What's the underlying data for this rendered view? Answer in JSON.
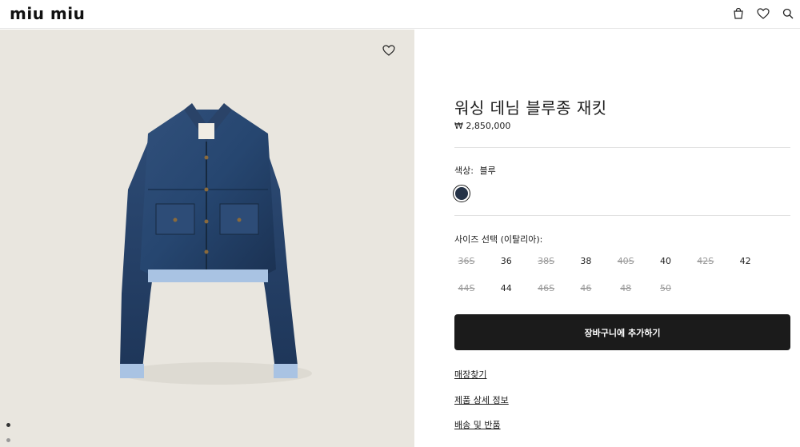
{
  "header": {
    "logo": "miu miu",
    "icons": [
      "bag-icon",
      "heart-icon",
      "search-icon"
    ]
  },
  "gallery": {
    "wishlist_icon": "heart-icon",
    "dots": 2
  },
  "product": {
    "title": "워싱 데님 블루종 재킷",
    "price": "₩ 2,850,000",
    "color_label": "색상:",
    "color_value": "블루",
    "color_swatch": "#243247",
    "size_label": "사이즈 선택 (이탈리아):",
    "sizes": [
      {
        "label": "36S",
        "available": false
      },
      {
        "label": "36",
        "available": true
      },
      {
        "label": "38S",
        "available": false
      },
      {
        "label": "38",
        "available": true
      },
      {
        "label": "40S",
        "available": false
      },
      {
        "label": "40",
        "available": true
      },
      {
        "label": "42S",
        "available": false
      },
      {
        "label": "42",
        "available": true
      },
      {
        "label": "44S",
        "available": false
      },
      {
        "label": "44",
        "available": true
      },
      {
        "label": "46S",
        "available": false
      },
      {
        "label": "46",
        "available": false
      },
      {
        "label": "48",
        "available": false
      },
      {
        "label": "50",
        "available": false
      }
    ],
    "add_to_cart": "장바구니에 추가하기",
    "links": [
      "매장찾기",
      "제품 상세 정보",
      "배송 및 반품"
    ]
  }
}
